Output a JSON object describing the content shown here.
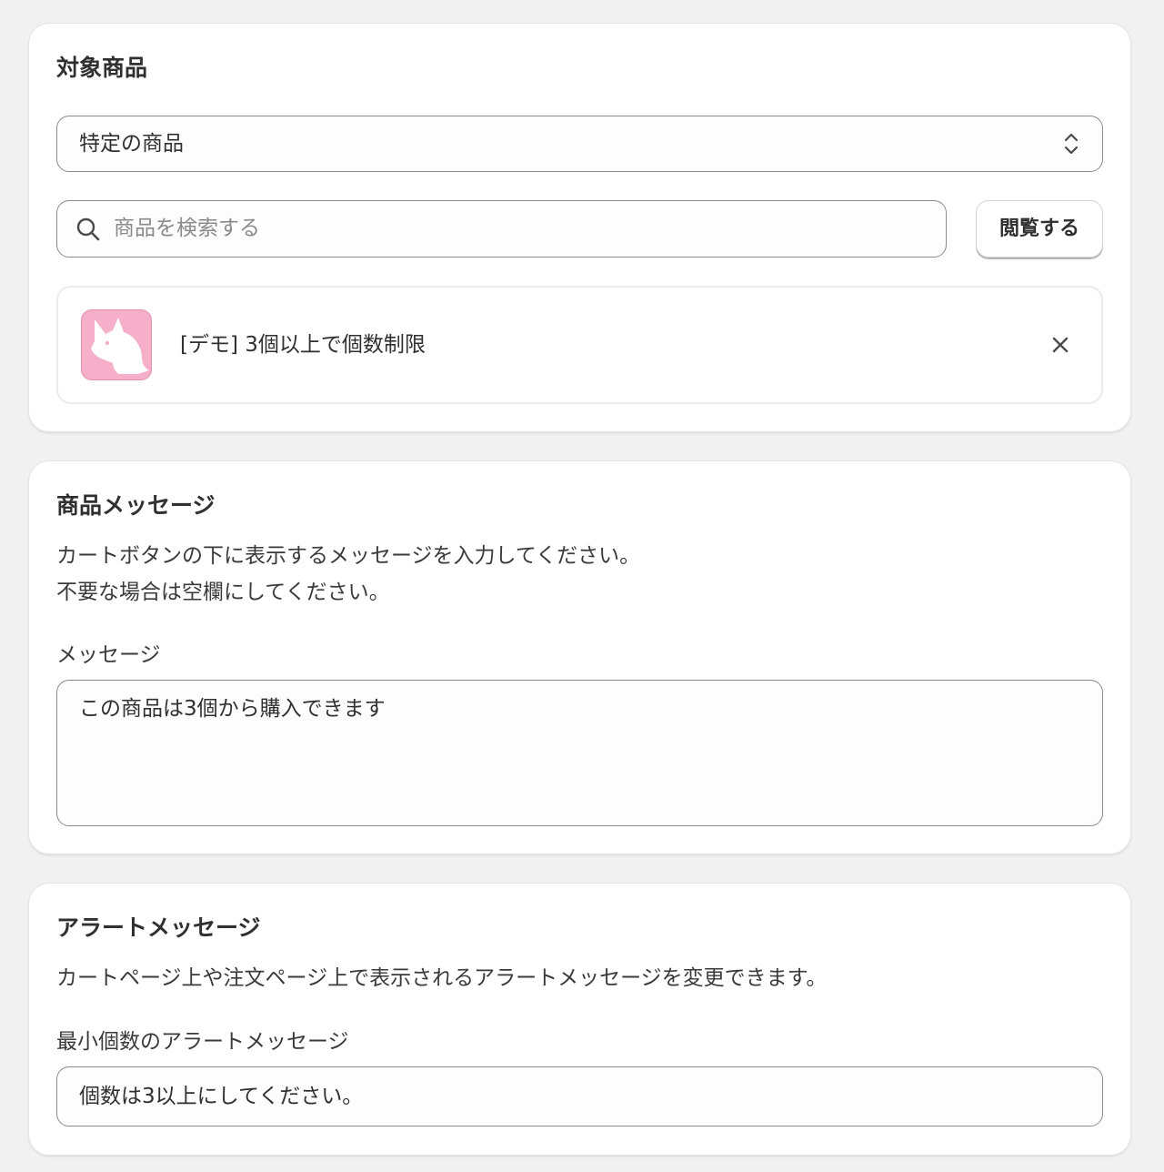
{
  "products_card": {
    "title": "対象商品",
    "scope_select": {
      "value": "特定の商品"
    },
    "search": {
      "placeholder": "商品を検索する"
    },
    "browse_label": "閲覧する",
    "selected_product": {
      "name": "[デモ] 3個以上で個数制限"
    }
  },
  "message_card": {
    "title": "商品メッセージ",
    "description_line1": "カートボタンの下に表示するメッセージを入力してください。",
    "description_line2": "不要な場合は空欄にしてください。",
    "field_label": "メッセージ",
    "field_value": "この商品は3個から購入できます"
  },
  "alert_card": {
    "title": "アラートメッセージ",
    "description": "カートページ上や注文ページ上で表示されるアラートメッセージを変更できます。",
    "field_label": "最小個数のアラートメッセージ",
    "field_value": "個数は3以上にしてください。"
  },
  "colors": {
    "page_bg": "#f1f1f1",
    "card_bg": "#ffffff",
    "thumb_pink": "#f5afc8"
  },
  "icons": [
    "chevron-up-down-icon",
    "search-icon",
    "dog-icon",
    "close-icon"
  ]
}
